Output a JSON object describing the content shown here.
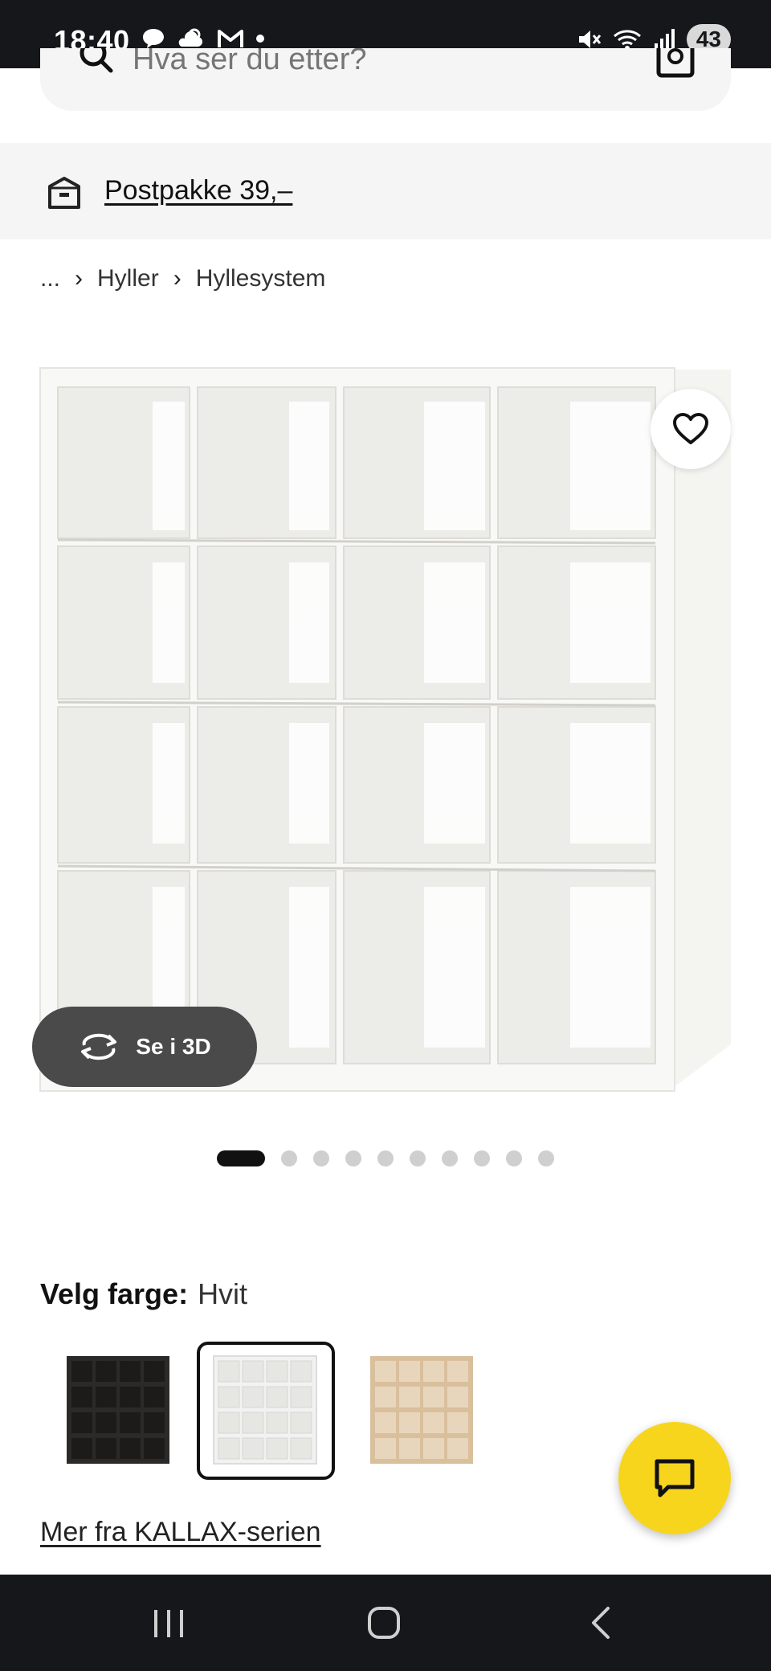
{
  "status_bar": {
    "time": "18:40",
    "battery": "43",
    "left_icons": [
      "chat-bubble-icon",
      "weather-icon",
      "gmail-icon",
      "dot-icon"
    ],
    "right_icons": [
      "mute-icon",
      "wifi-icon",
      "signal-icon"
    ]
  },
  "search": {
    "placeholder": "Hva ser du etter?"
  },
  "shipping": {
    "label": "Postpakke 39,–"
  },
  "breadcrumb": {
    "items": [
      "...",
      "Hyller",
      "Hyllesystem"
    ]
  },
  "product": {
    "view3d_label": "Se i 3D",
    "image_count": 10,
    "active_image": 1
  },
  "color": {
    "label": "Velg farge:",
    "selected": "Hvit",
    "swatches": [
      {
        "name": "black-brown",
        "color": "#2b2a29"
      },
      {
        "name": "white",
        "color": "#f2f2f2"
      },
      {
        "name": "oak-effect",
        "color": "#d9bf9c"
      }
    ]
  },
  "series_link": "Mer fra KALLAX-serien",
  "colors": {
    "brand_yellow": "#f7d51d",
    "dark_bar": "#16171a",
    "banner_bg": "#f5f5f5"
  }
}
